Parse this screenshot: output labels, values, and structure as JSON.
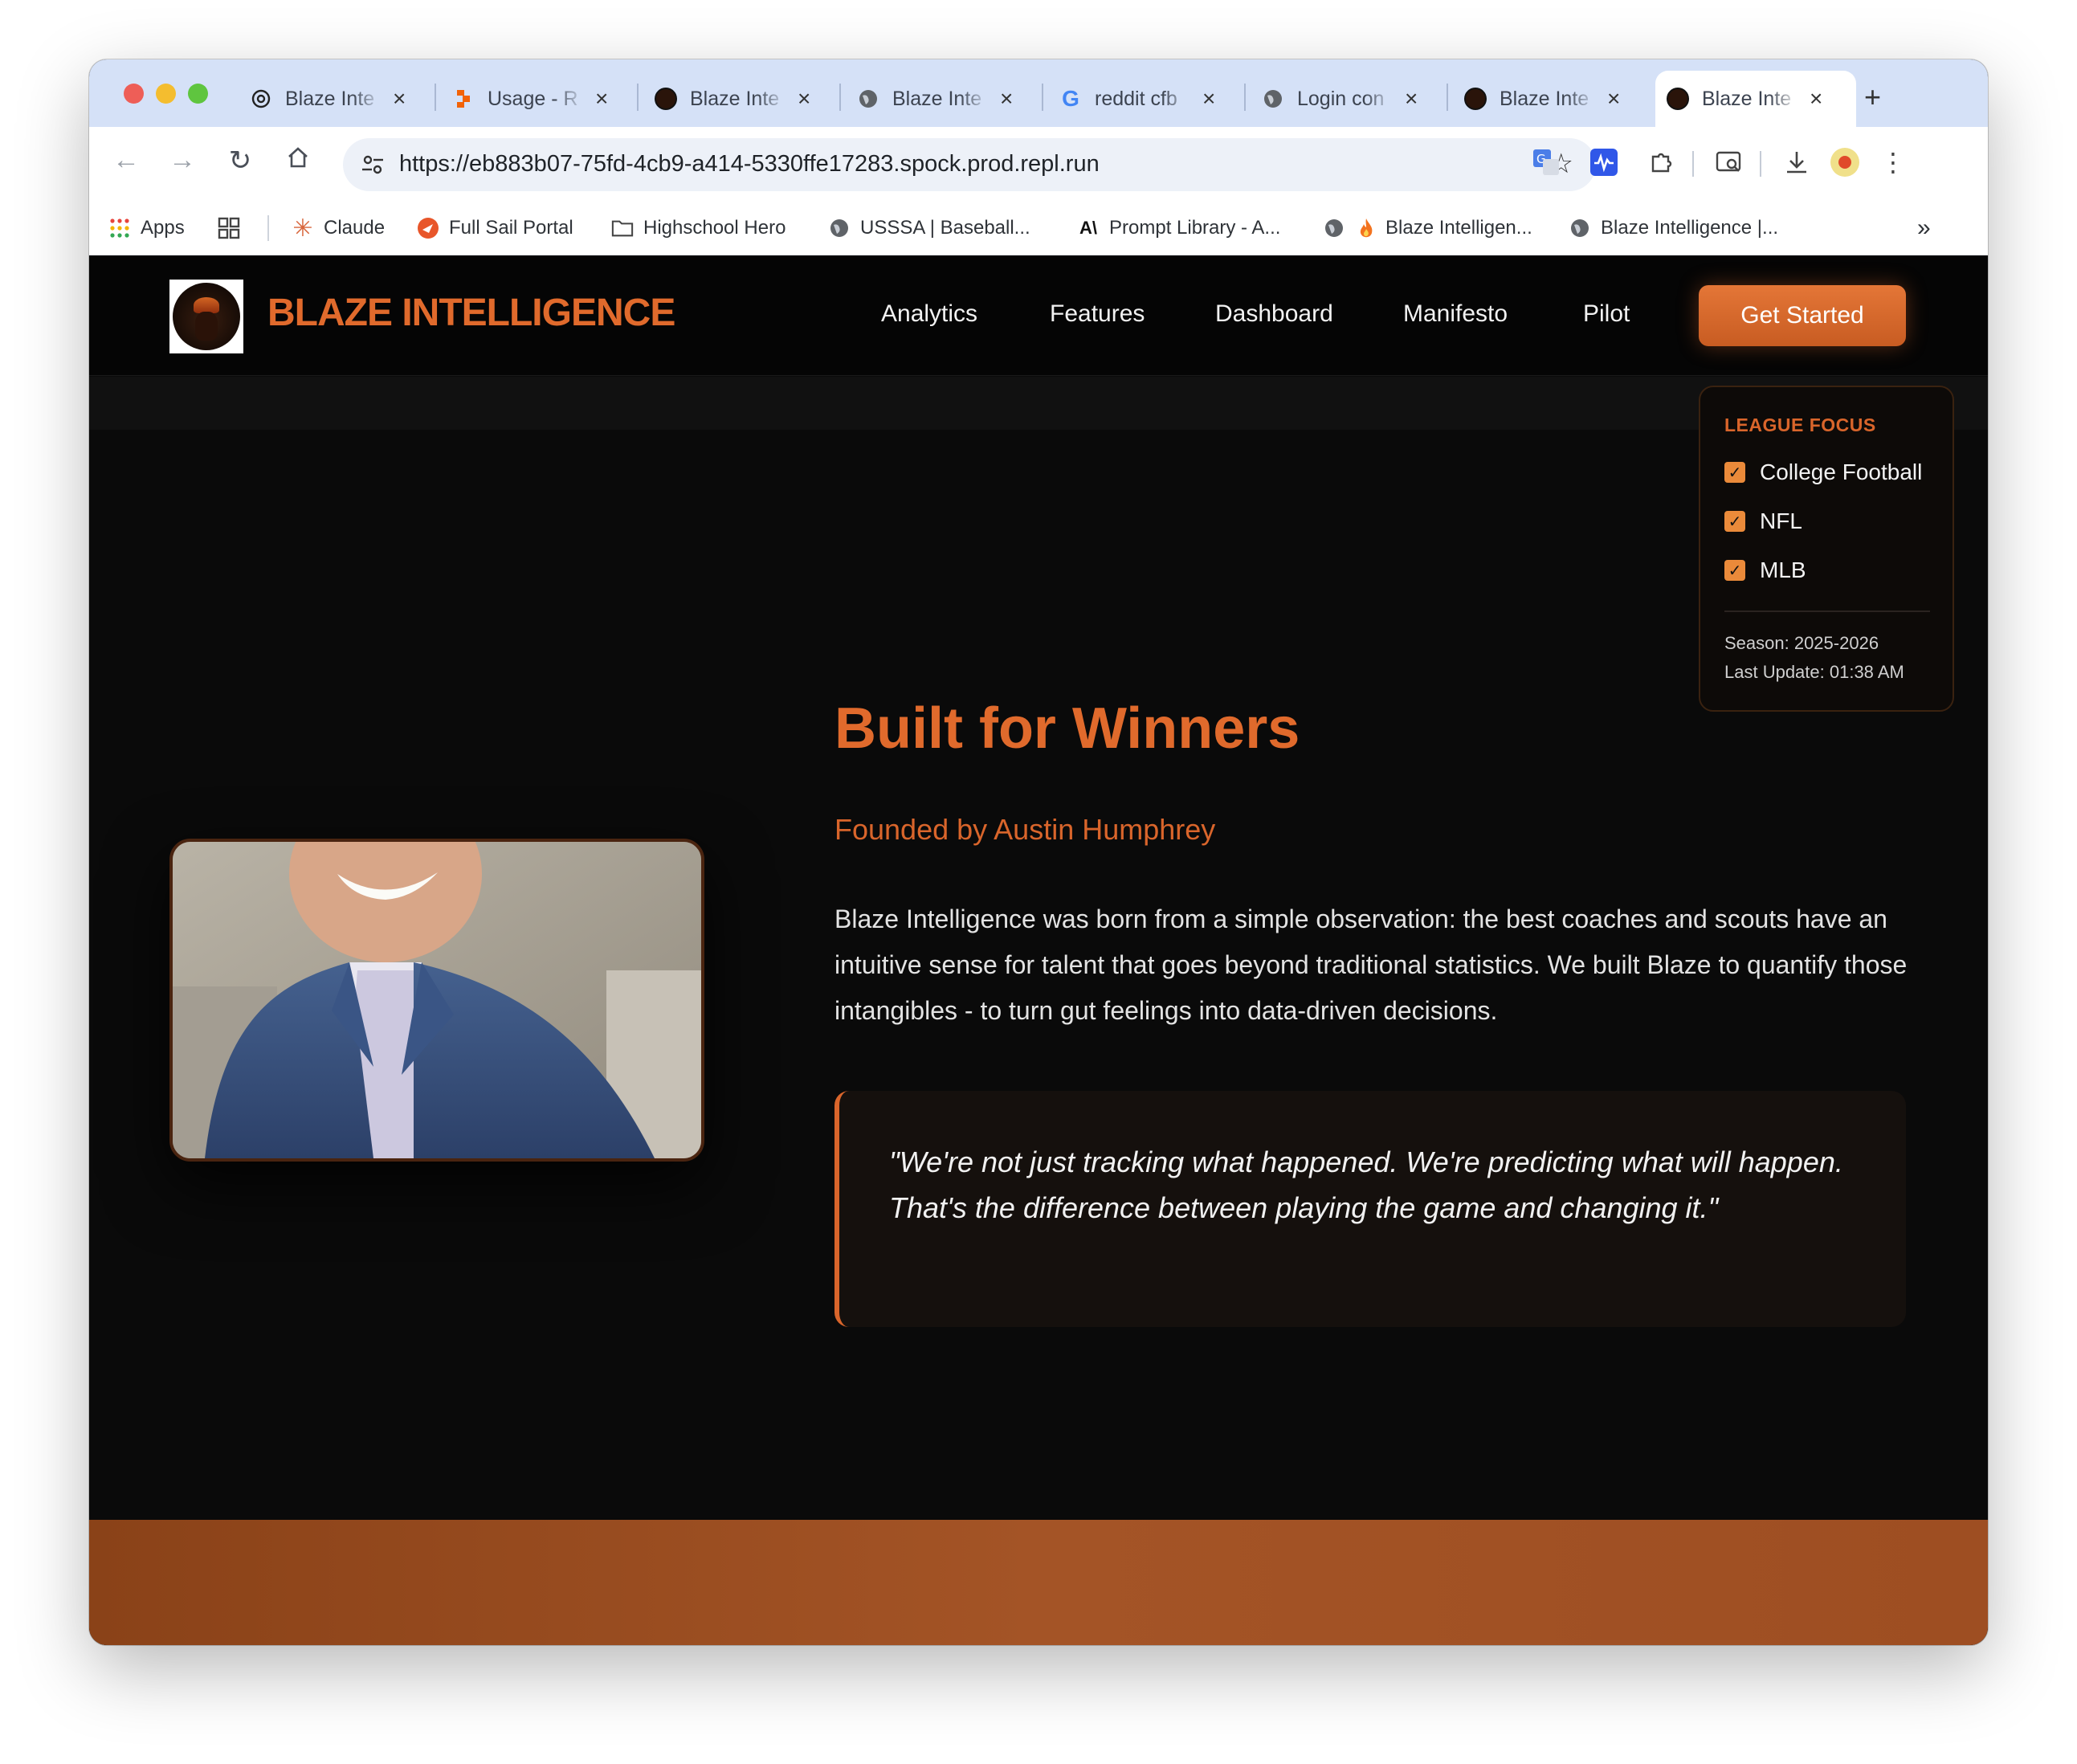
{
  "browser": {
    "tabs": [
      {
        "title": "Blaze Inte",
        "icon": "openai-icon"
      },
      {
        "title": "Usage - R",
        "icon": "replit-icon"
      },
      {
        "title": "Blaze Inte",
        "icon": "blaze-logo-icon"
      },
      {
        "title": "Blaze Inte",
        "icon": "globe-icon"
      },
      {
        "title": "reddit cfb",
        "icon": "google-icon"
      },
      {
        "title": "Login con",
        "icon": "globe-icon"
      },
      {
        "title": "Blaze Inte",
        "icon": "blaze-logo-icon"
      },
      {
        "title": "Blaze Inte",
        "icon": "blaze-logo-icon",
        "active": true
      }
    ],
    "url": "https://eb883b07-75fd-4cb9-a414-5330ffe17283.spock.prod.repl.run",
    "bookmarks": [
      {
        "label": "Apps",
        "icon": "apps-grid-icon"
      },
      {
        "label": "Claude",
        "icon": "claude-icon"
      },
      {
        "label": "Full Sail Portal",
        "icon": "fullsail-icon"
      },
      {
        "label": "Highschool Hero",
        "icon": "folder-icon"
      },
      {
        "label": "USSSA | Baseball...",
        "icon": "globe-icon"
      },
      {
        "label": "Prompt Library - A...",
        "icon": "anthropic-icon"
      },
      {
        "label": "Blaze Intelligen...",
        "icon": "fire-icon"
      },
      {
        "label": "Blaze Intelligence |...",
        "icon": "globe-icon"
      }
    ]
  },
  "site": {
    "brand": "BLAZE INTELLIGENCE",
    "nav": [
      "Analytics",
      "Features",
      "Dashboard",
      "Manifesto",
      "Pilot"
    ],
    "cta": "Get Started",
    "league_panel": {
      "title": "LEAGUE FOCUS",
      "options": [
        {
          "label": "College Football",
          "checked": true
        },
        {
          "label": "NFL",
          "checked": true
        },
        {
          "label": "MLB",
          "checked": true
        }
      ],
      "season": "Season: 2025-2026",
      "last_update": "Last Update: 01:38 AM"
    },
    "about": {
      "headline": "Built for Winners",
      "subhead": "Founded by Austin Humphrey",
      "paragraph": "Blaze Intelligence was born from a simple observation: the best coaches and scouts have an intuitive sense for talent that goes beyond traditional statistics. We built Blaze to quantify those intangibles - to turn gut feelings into data-driven decisions.",
      "quote": "\"We're not just tracking what happened. We're predicting what will happen. That's the difference between playing the game and changing it.\""
    }
  },
  "colors": {
    "accent": "#e06a2c",
    "background": "#0a0a0a",
    "band": "#a45426"
  }
}
